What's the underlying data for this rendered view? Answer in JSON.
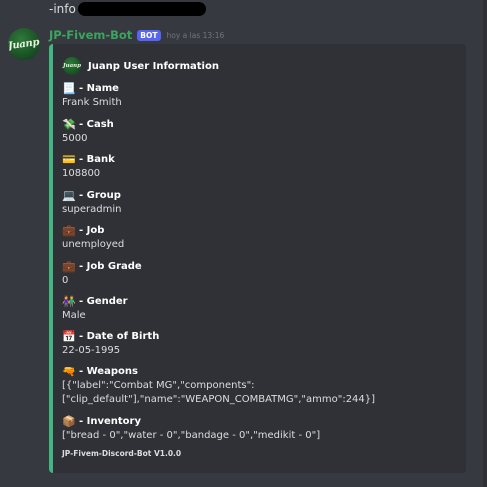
{
  "prev_message": {
    "text": "-info"
  },
  "header": {
    "username": "JP-Fivem-Bot",
    "bot_tag": "BOT",
    "timestamp": "hoy a las 13:16",
    "avatar_label": "Juanp"
  },
  "colors": {
    "background": "#36393f",
    "embed_bg": "#2f3136",
    "embed_accent": "#43b581",
    "username": "#3ba55d",
    "bot_tag": "#5865f2"
  },
  "embed": {
    "author_icon_label": "Juanp",
    "author": "Juanp User Information",
    "fields": [
      {
        "icon": "📃",
        "icon_name": "page-icon",
        "title": "- Name",
        "value": "Frank Smith"
      },
      {
        "icon": "💸",
        "icon_name": "money-icon",
        "title": "- Cash",
        "value": "5000"
      },
      {
        "icon": "💳",
        "icon_name": "credit-card-icon",
        "title": "- Bank",
        "value": "108800"
      },
      {
        "icon": "💻",
        "icon_name": "laptop-icon",
        "title": "- Group",
        "value": "superadmin"
      },
      {
        "icon": "💼",
        "icon_name": "briefcase-icon",
        "title": "- Job",
        "value": "unemployed"
      },
      {
        "icon": "💼",
        "icon_name": "briefcase-icon",
        "title": "- Job Grade",
        "value": "0"
      },
      {
        "icon": "👫",
        "icon_name": "people-icon",
        "title": "- Gender",
        "value": "Male"
      },
      {
        "icon": "📅",
        "icon_name": "calendar-icon",
        "title": "- Date of Birth",
        "value": "22-05-1995"
      },
      {
        "icon": "🔫",
        "icon_name": "gun-icon",
        "title": "- Weapons",
        "value_lines": [
          "[{\"label\":\"Combat MG\",\"components\":",
          "[\"clip_default\"],\"name\":\"WEAPON_COMBATMG\",\"ammo\":244}]"
        ]
      },
      {
        "icon": "📦",
        "icon_name": "package-icon",
        "title": "- Inventory",
        "value": "[\"bread - 0\",\"water - 0\",\"bandage - 0\",\"medikit - 0\"]"
      }
    ],
    "footer": "JP-Fivem-Discord-Bot V1.0.0"
  }
}
